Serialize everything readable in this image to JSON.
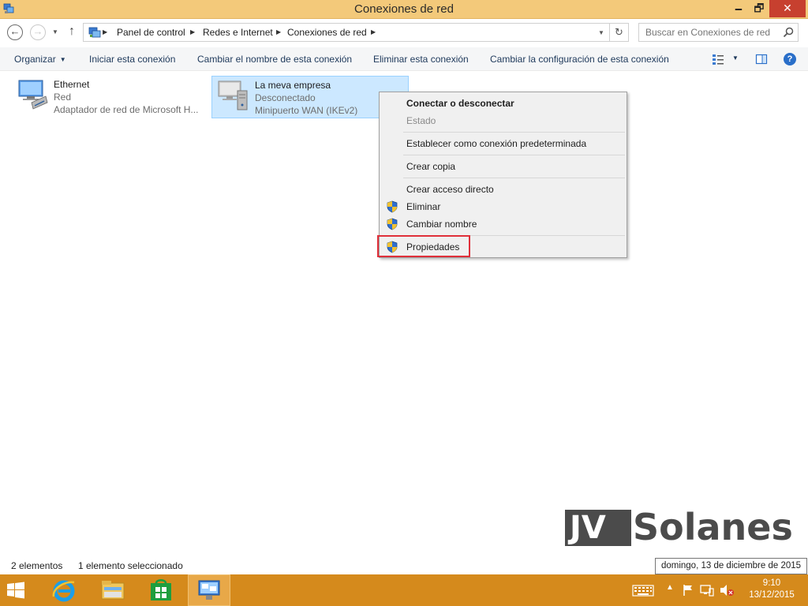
{
  "window": {
    "title": "Conexiones de red",
    "min_glyph": "🗕",
    "max_glyph": "🗗",
    "close_glyph": "✕"
  },
  "address": {
    "back_glyph": "←",
    "forward_glyph": "→",
    "up_glyph": "↑",
    "refresh_glyph": "↻",
    "crumbs": [
      "Panel de control",
      "Redes e Internet",
      "Conexiones de red"
    ],
    "search_placeholder": "Buscar en Conexiones de red"
  },
  "toolbar": {
    "organize": "Organizar",
    "start": "Iniciar esta conexión",
    "rename": "Cambiar el nombre de esta conexión",
    "delete": "Eliminar esta conexión",
    "change_settings": "Cambiar la configuración de esta conexión",
    "help_glyph": "?"
  },
  "items": [
    {
      "name": "Ethernet",
      "status": "Red",
      "device": "Adaptador de red de Microsoft H...",
      "icon": "network-adapter-icon"
    },
    {
      "name": "La meva empresa",
      "status": "Desconectado",
      "device": "Minipuerto WAN (IKEv2)",
      "icon": "vpn-connection-icon"
    }
  ],
  "context_menu": {
    "items": [
      {
        "label": "Conectar o desconectar",
        "style": "bold"
      },
      {
        "label": "Estado",
        "style": "disabled"
      },
      {
        "label": "Establecer como conexión predeterminada"
      },
      {
        "label": "Crear copia"
      },
      {
        "label": "Crear acceso directo"
      },
      {
        "label": "Eliminar",
        "icon": "uac-shield-icon"
      },
      {
        "label": "Cambiar nombre",
        "icon": "uac-shield-icon"
      },
      {
        "label": "Propiedades",
        "icon": "uac-shield-icon",
        "highlighted": true
      }
    ]
  },
  "statusbar": {
    "count": "2 elementos",
    "selection": "1 elemento seleccionado"
  },
  "tooltip": "domingo, 13 de diciembre de 2015",
  "watermark": {
    "part1": "JV",
    "part2": "Solanes"
  },
  "taskbar": {
    "time": "9:10",
    "date": "13/12/2015"
  },
  "colors": {
    "titlebar": "#f3c97a",
    "taskbar": "#d58a1c",
    "selection": "#cce8ff",
    "highlight_box": "#e0303a",
    "close_button": "#c7402f"
  }
}
